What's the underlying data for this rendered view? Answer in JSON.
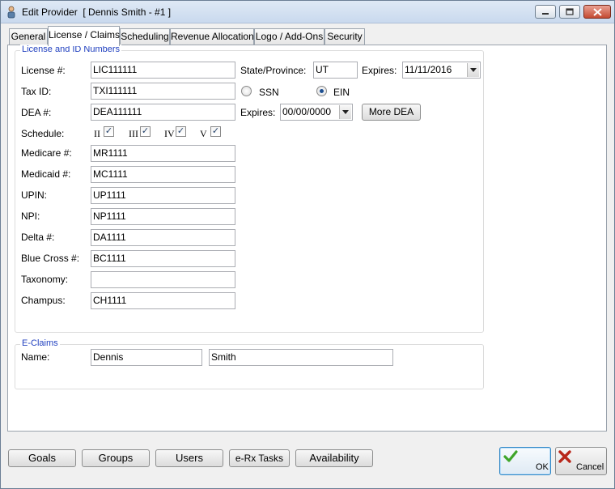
{
  "window": {
    "title": "Edit Provider  [ Dennis Smith - #1 ]"
  },
  "tabs": [
    {
      "label": "General"
    },
    {
      "label": "License / Claims",
      "active": true
    },
    {
      "label": "Scheduling"
    },
    {
      "label": "Revenue Allocation"
    },
    {
      "label": "Logo / Add-Ons"
    },
    {
      "label": "Security"
    }
  ],
  "license_group": {
    "title": "License and  ID Numbers",
    "license_label": "License #:",
    "license_value": "LIC111111",
    "state_label": "State/Province:",
    "state_value": "UT",
    "expires_label": "Expires:",
    "expires_value": "11/11/2016",
    "tax_label": "Tax ID:",
    "tax_value": "TXI111111",
    "ssn_label": "SSN",
    "ein_label": "EIN",
    "tax_type_selected": "EIN",
    "dea_label": "DEA #:",
    "dea_value": "DEA111111",
    "dea_expires_label": "Expires:",
    "dea_expires_value": "00/00/0000",
    "more_dea_label": "More DEA",
    "schedule_label": "Schedule:",
    "schedules": [
      {
        "label": "II",
        "checked": true
      },
      {
        "label": "III",
        "checked": true
      },
      {
        "label": "IV",
        "checked": true
      },
      {
        "label": "V",
        "checked": true
      }
    ],
    "fields": [
      {
        "label": "Medicare #:",
        "value": "MR1111"
      },
      {
        "label": "Medicaid #:",
        "value": "MC1111"
      },
      {
        "label": "UPIN:",
        "value": "UP1111"
      },
      {
        "label": "NPI:",
        "value": "NP1111"
      },
      {
        "label": "Delta #:",
        "value": "DA1111"
      },
      {
        "label": "Blue Cross #:",
        "value": "BC1111"
      },
      {
        "label": "Taxonomy:",
        "value": ""
      },
      {
        "label": "Champus:",
        "value": "CH1111"
      }
    ]
  },
  "eclaims_group": {
    "title": "E-Claims",
    "name_label": "Name:",
    "first_name": "Dennis",
    "last_name": "Smith"
  },
  "footer_buttons": [
    {
      "label": "Goals"
    },
    {
      "label": "Groups"
    },
    {
      "label": "Users"
    },
    {
      "label": "e-Rx Tasks"
    },
    {
      "label": "Availability"
    }
  ],
  "ok_label": "OK",
  "cancel_label": "Cancel",
  "colors": {
    "group_title": "#1f3fbf",
    "ok_check": "#3fa52a",
    "cancel_x": "#b8271a"
  },
  "icons": [
    "provider-icon",
    "minimize-icon",
    "maximize-icon",
    "close-icon",
    "dropdown-arrow-icon",
    "ok-check-icon",
    "cancel-x-icon"
  ]
}
